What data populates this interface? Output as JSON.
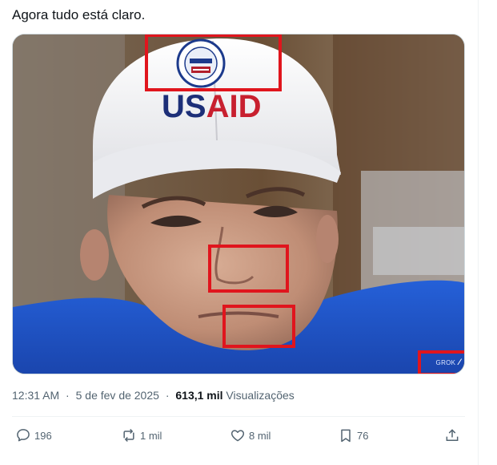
{
  "tweet": {
    "text": "Agora tudo está claro."
  },
  "media": {
    "cap_brand": "USAID",
    "badge_text": "GROK",
    "highlight_color": "#e0151d",
    "shirt_color": "#1b4fc6",
    "cap_color": "#f4f4f6"
  },
  "meta": {
    "time": "12:31 AM",
    "separator": "·",
    "date": "5 de fev de 2025",
    "views_count": "613,1 mil",
    "views_label": "Visualizações"
  },
  "actions": {
    "replies": "196",
    "reposts": "1 mil",
    "likes": "8 mil",
    "bookmarks": "76",
    "icons": [
      "reply-icon",
      "repost-icon",
      "like-icon",
      "bookmark-icon",
      "share-icon"
    ]
  }
}
